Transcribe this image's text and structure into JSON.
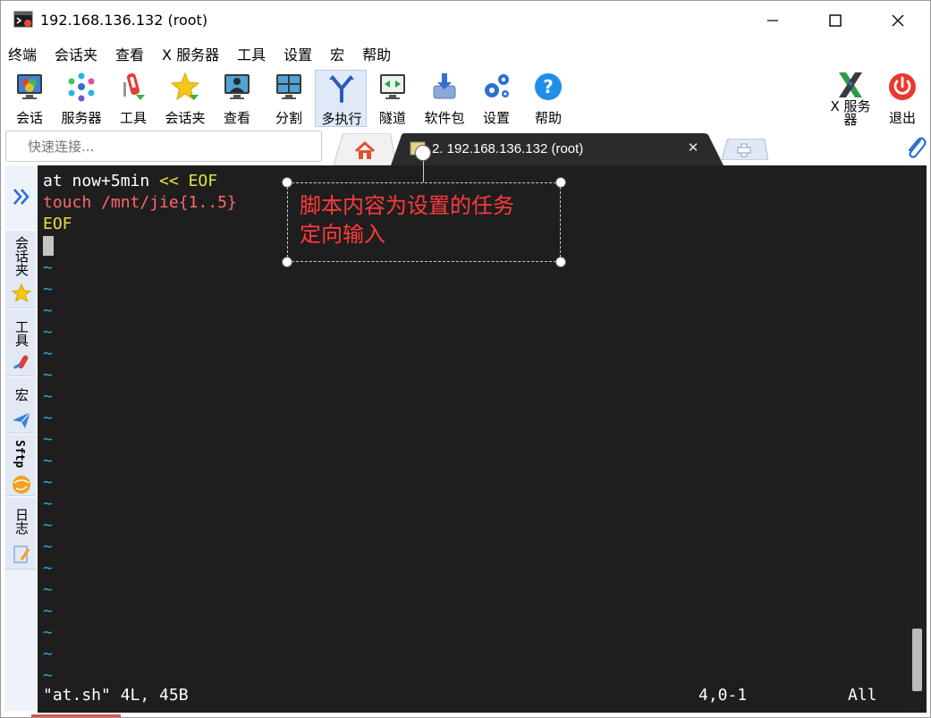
{
  "window": {
    "title": "192.168.136.132 (root)"
  },
  "menu": [
    "终端",
    "会话夹",
    "查看",
    "X 服务器",
    "工具",
    "设置",
    "宏",
    "帮助"
  ],
  "toolbar": {
    "items": [
      {
        "label": "会话",
        "icon": "session-icon"
      },
      {
        "label": "服务器",
        "icon": "servers-icon"
      },
      {
        "label": "工具",
        "icon": "tools-icon"
      },
      {
        "label": "会话夹",
        "icon": "star-icon"
      },
      {
        "label": "查看",
        "icon": "view-icon"
      },
      {
        "label": "分割",
        "icon": "split-icon"
      },
      {
        "label": "多执行",
        "icon": "multiexec-icon"
      },
      {
        "label": "隧道",
        "icon": "tunnel-icon"
      },
      {
        "label": "软件包",
        "icon": "package-icon"
      },
      {
        "label": "设置",
        "icon": "settings-icon"
      },
      {
        "label": "帮助",
        "icon": "help-icon"
      }
    ],
    "xserver_label": "X 服务\n器",
    "exit_label": "退出"
  },
  "quick_connect": {
    "placeholder": "快速连接..."
  },
  "tabs": {
    "active_label": "2. 192.168.136.132 (root)",
    "close_glyph": "✕"
  },
  "side_panel": {
    "items": [
      "会话夹",
      "工具",
      "宏",
      "Sftp",
      "日志"
    ]
  },
  "terminal": {
    "line1": {
      "a": "at now+5min ",
      "b": "<< EOF"
    },
    "line2": "touch /mnt/jie{1..5}",
    "line3": "EOF",
    "tilde": "~",
    "status_file": "\"at.sh\" 4L, 45B",
    "status_pos": "4,0-1",
    "status_scroll": "All"
  },
  "annotation": {
    "line1": "脚本内容为设置的任务",
    "line2": "定向输入",
    "color": "#ff3a3a"
  },
  "colors": {
    "terminal_bg": "#1e1e1e",
    "cyan": "#2fa6d8",
    "yellow": "#e5e04a",
    "red": "#ff6868",
    "accent_tab": "#2b2b2b"
  }
}
